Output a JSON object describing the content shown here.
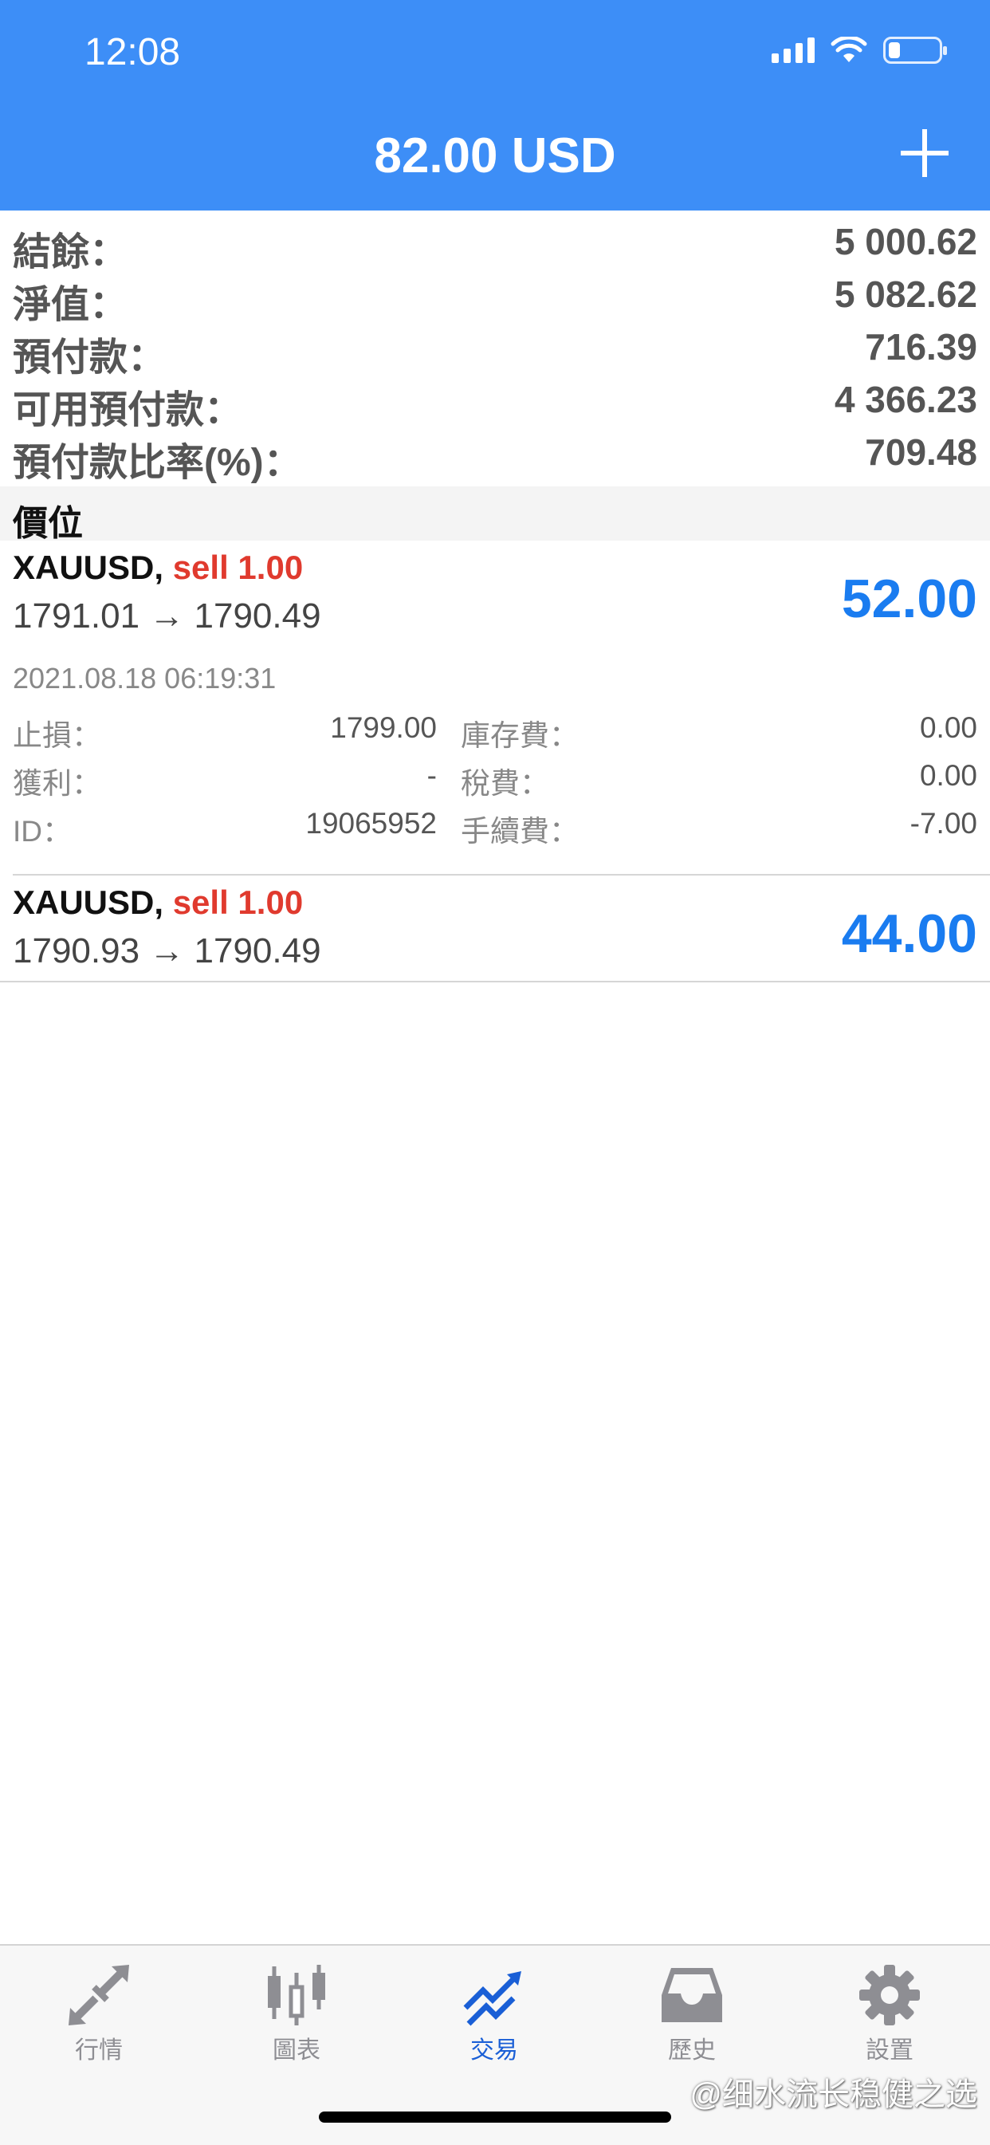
{
  "status_bar": {
    "time": "12:08"
  },
  "header": {
    "title": "82.00 USD"
  },
  "summary": [
    {
      "label": "結餘：",
      "value": "5 000.62"
    },
    {
      "label": "淨值：",
      "value": "5 082.62"
    },
    {
      "label": "預付款：",
      "value": "716.39"
    },
    {
      "label": "可用預付款：",
      "value": "4 366.23"
    },
    {
      "label": "預付款比率(%)：",
      "value": "709.48"
    }
  ],
  "positions_header": "價位",
  "positions": [
    {
      "symbol": "XAUUSD,",
      "side": "sell 1.00",
      "prices": "1791.01 → 1790.49",
      "profit": "52.00",
      "time": "2021.08.18 06:19:31",
      "details": {
        "sl_label": "止損：",
        "sl_value": "1799.00",
        "tp_label": "獲利：",
        "tp_value": "-",
        "id_label": "ID：",
        "id_value": "19065952",
        "swap_label": "庫存費：",
        "swap_value": "0.00",
        "tax_label": "稅費：",
        "tax_value": "0.00",
        "commission_label": "手續費：",
        "commission_value": "-7.00"
      }
    },
    {
      "symbol": "XAUUSD,",
      "side": "sell 1.00",
      "prices": "1790.93 → 1790.49",
      "profit": "44.00"
    }
  ],
  "tabs": [
    {
      "label": "行情",
      "icon": "quotes-arrows-icon",
      "active": false
    },
    {
      "label": "圖表",
      "icon": "candlestick-chart-icon",
      "active": false
    },
    {
      "label": "交易",
      "icon": "trade-trend-icon",
      "active": true
    },
    {
      "label": "歷史",
      "icon": "inbox-tray-icon",
      "active": false
    },
    {
      "label": "設置",
      "icon": "gear-icon",
      "active": false
    }
  ],
  "watermark": "@细水流长稳健之选",
  "colors": {
    "header_bg": "#3d8ef7",
    "profit": "#1a7cf0",
    "sell": "#e03a2e",
    "tab_active": "#1a5fd6"
  }
}
